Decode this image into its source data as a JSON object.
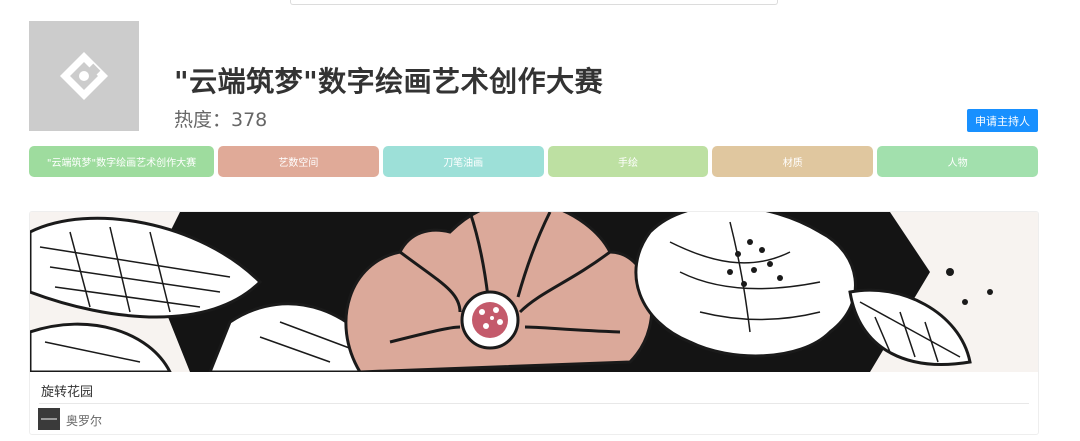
{
  "contest": {
    "title": "\"云端筑梦\"数字绘画艺术创作大赛",
    "heat_label": "热度：378",
    "heat_value": 378,
    "logo_icon": "contest-logo-icon"
  },
  "apply_button_label": "申请主持人",
  "tags": [
    {
      "label": "\"云端筑梦\"数字绘画艺术创作大赛",
      "color": "#9edc9e"
    },
    {
      "label": "艺数空间",
      "color": "#e0aa98"
    },
    {
      "label": "刀笔油画",
      "color": "#9de0d8"
    },
    {
      "label": "手绘",
      "color": "#bde0a2"
    },
    {
      "label": "材质",
      "color": "#e0c79f"
    },
    {
      "label": "人物",
      "color": "#a2e0ad"
    }
  ],
  "artworks": [
    {
      "title": "旋转花园",
      "author": "奥罗尔",
      "avatar_icon": "author-avatar-icon",
      "image": "floral-ink-illustration"
    }
  ]
}
